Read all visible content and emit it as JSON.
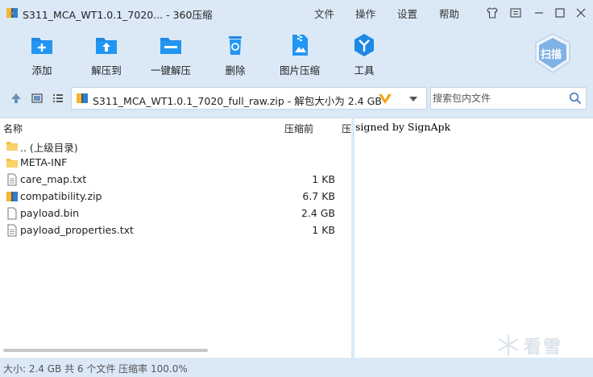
{
  "window": {
    "title": "S311_MCA_WT1.0.1_7020... - 360压缩",
    "menu": [
      "文件",
      "操作",
      "设置",
      "帮助"
    ]
  },
  "toolbar": {
    "items": [
      {
        "label": "添加",
        "icon": "add-folder-icon"
      },
      {
        "label": "解压到",
        "icon": "extract-to-icon"
      },
      {
        "label": "一键解压",
        "icon": "one-click-extract-icon"
      },
      {
        "label": "删除",
        "icon": "trash-icon"
      },
      {
        "label": "图片压缩",
        "icon": "image-compress-icon"
      },
      {
        "label": "工具",
        "icon": "tools-icon"
      }
    ],
    "scan_label": "扫描"
  },
  "address": {
    "path": "S311_MCA_WT1.0.1_7020_full_raw.zip - 解包大小为 2.4 GB"
  },
  "search": {
    "placeholder": "搜索包内文件"
  },
  "filelist": {
    "columns": {
      "name": "名称",
      "before": "压缩前",
      "ratio": "压缩率"
    },
    "rows": [
      {
        "name": ".. (上级目录)",
        "size": "",
        "icon": "folder-up-icon"
      },
      {
        "name": "META-INF",
        "size": "",
        "icon": "folder-icon"
      },
      {
        "name": "care_map.txt",
        "size": "1 KB",
        "icon": "text-file-icon"
      },
      {
        "name": "compatibility.zip",
        "size": "6.7 KB",
        "icon": "zip-file-icon"
      },
      {
        "name": "payload.bin",
        "size": "2.4 GB",
        "icon": "file-icon"
      },
      {
        "name": "payload_properties.txt",
        "size": "1 KB",
        "icon": "text-file-icon"
      }
    ]
  },
  "preview": {
    "text": "signed by SignApk",
    "watermark": "看雪"
  },
  "status": {
    "text": "大小: 2.4 GB 共 6 个文件 压缩率 100.0%"
  },
  "colors": {
    "chrome_bg": "#dbe9f7",
    "accent_blue": "#1e88e5",
    "folder_yellow": "#f5c242"
  }
}
